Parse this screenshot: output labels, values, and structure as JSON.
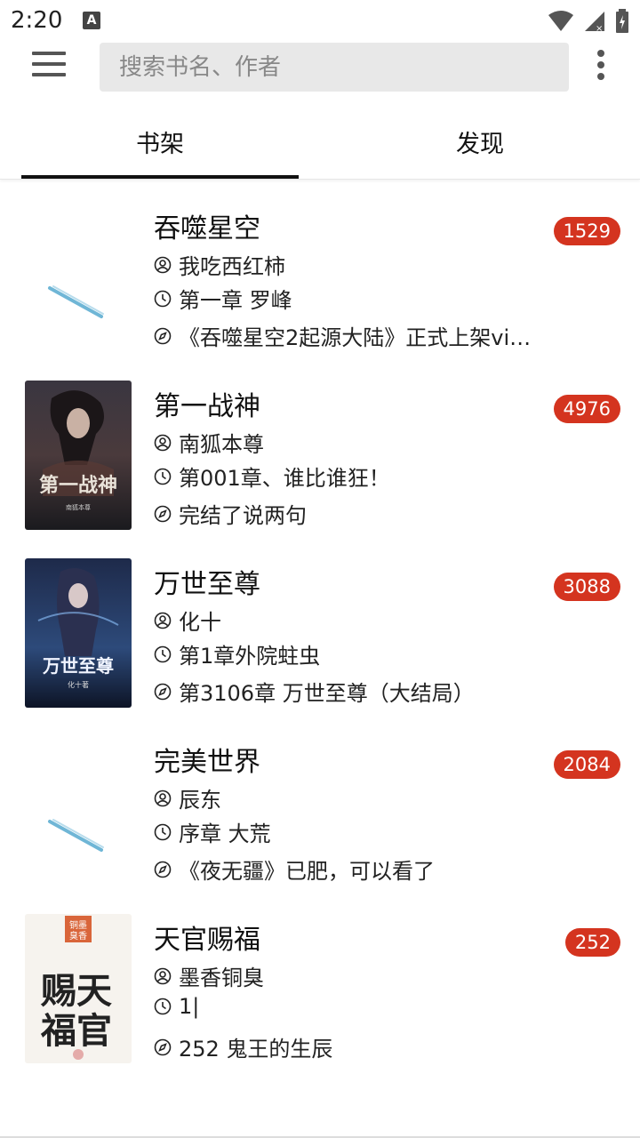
{
  "status_bar": {
    "time": "2:20",
    "notification_letter": "A"
  },
  "search": {
    "placeholder": "搜索书名、作者"
  },
  "tabs": [
    {
      "label": "书架",
      "active": true
    },
    {
      "label": "发现",
      "active": false
    }
  ],
  "books": [
    {
      "title": "吞噬星空",
      "author": "我吃西红柿",
      "chapter": "第一章 罗峰",
      "latest": "《吞噬星空2起源大陆》正式上架vi…",
      "unread": "1529",
      "cover": "loading"
    },
    {
      "title": "第一战神",
      "author": "南狐本尊",
      "chapter": "第001章、谁比谁狂！",
      "latest": "完结了说两句",
      "unread": "4976",
      "cover": "第一战神"
    },
    {
      "title": "万世至尊",
      "author": "化十",
      "chapter": "第1章外院蛀虫",
      "latest": "第3106章 万世至尊（大结局）",
      "unread": "3088",
      "cover": "万世至尊"
    },
    {
      "title": "完美世界",
      "author": "辰东",
      "chapter": "序章 大荒",
      "latest": "《夜无疆》已肥，可以看了",
      "unread": "2084",
      "cover": "loading"
    },
    {
      "title": "天官赐福",
      "author": "墨香铜臭",
      "chapter": "1|",
      "latest": "252 鬼王的生辰",
      "unread": "252",
      "cover": "天官赐福"
    }
  ],
  "colors": {
    "badge": "#d4341f",
    "tab_indicator": "#111111",
    "search_bg": "#e8e8e8"
  }
}
